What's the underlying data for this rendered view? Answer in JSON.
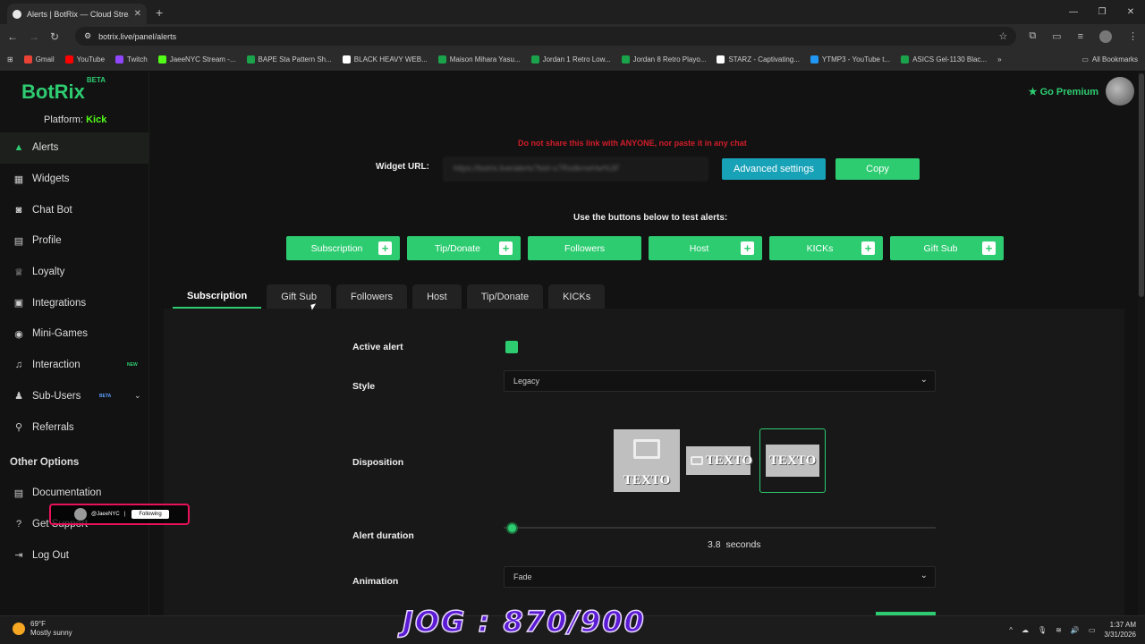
{
  "browser": {
    "tab_title": "Alerts | BotRix — Cloud Streami",
    "url": "botrix.live/panel/alerts",
    "bookmarks": [
      {
        "label": "Gmail",
        "color": "#ea4335"
      },
      {
        "label": "YouTube",
        "color": "#ff0000"
      },
      {
        "label": "Twitch",
        "color": "#9146ff"
      },
      {
        "label": "JaeeNYC Stream -...",
        "color": "#53fc18"
      },
      {
        "label": "BAPE Sta Pattern Sh...",
        "color": "#1aa34a"
      },
      {
        "label": "BLACK HEAVY WEB...",
        "color": "#ffffff"
      },
      {
        "label": "Maison Mihara Yasu...",
        "color": "#1aa34a"
      },
      {
        "label": "Jordan 1 Retro Low...",
        "color": "#1aa34a"
      },
      {
        "label": "Jordan 8 Retro Playo...",
        "color": "#1aa34a"
      },
      {
        "label": "STARZ - Captivating...",
        "color": "#ffffff"
      },
      {
        "label": "YTMP3 - YouTube t...",
        "color": "#2196f3"
      },
      {
        "label": "ASICS Gel-1130 Blac...",
        "color": "#1aa34a"
      }
    ],
    "all_bookmarks": "All Bookmarks"
  },
  "app": {
    "logo": "BotRix",
    "logo_badge": "BETA",
    "platform_label": "Platform:",
    "platform_value": "Kick",
    "go_premium": "Go Premium",
    "nav": [
      {
        "label": "Alerts",
        "icon": "warning-icon"
      },
      {
        "label": "Widgets",
        "icon": "grid-icon"
      },
      {
        "label": "Chat Bot",
        "icon": "robot-icon"
      },
      {
        "label": "Profile",
        "icon": "profile-card-icon"
      },
      {
        "label": "Loyalty",
        "icon": "trophy-icon"
      },
      {
        "label": "Integrations",
        "icon": "integrations-icon"
      },
      {
        "label": "Mini-Games",
        "icon": "gamepad-icon"
      },
      {
        "label": "Interaction",
        "icon": "music-icon",
        "badge": "NEW"
      },
      {
        "label": "Sub-Users",
        "icon": "users-icon",
        "badge": "BETA"
      },
      {
        "label": "Referrals",
        "icon": "referrals-icon"
      }
    ],
    "other_options_title": "Other Options",
    "other_nav": [
      {
        "label": "Documentation",
        "icon": "document-icon"
      },
      {
        "label": "Get Support",
        "icon": "help-icon"
      },
      {
        "label": "Log Out",
        "icon": "logout-icon"
      }
    ]
  },
  "main": {
    "warning": "Do not share this link with ANYONE, nor paste it in any chat",
    "widget_url_label": "Widget URL:",
    "widget_url_value": "https://botrix.live/alerts?bid=x7RsdkrrwHw%3F",
    "advanced_settings": "Advanced settings",
    "copy": "Copy",
    "test_label": "Use the buttons below to test alerts:",
    "test_buttons": [
      {
        "label": "Subscription",
        "plus": true
      },
      {
        "label": "Tip/Donate",
        "plus": true
      },
      {
        "label": "Followers",
        "plus": false
      },
      {
        "label": "Host",
        "plus": true
      },
      {
        "label": "KICKs",
        "plus": true
      },
      {
        "label": "Gift Sub",
        "plus": true
      }
    ],
    "tabs": [
      "Subscription",
      "Gift Sub",
      "Followers",
      "Host",
      "Tip/Donate",
      "KICKs"
    ],
    "active_tab": "Subscription",
    "form": {
      "active_alert_label": "Active alert",
      "active_alert_checked": true,
      "style_label": "Style",
      "style_value": "Legacy",
      "disposition_label": "Disposition",
      "disposition_text": "TEXTO",
      "alert_duration_label": "Alert duration",
      "alert_duration_value": "3.8",
      "alert_duration_unit": "seconds",
      "animation_label": "Animation",
      "animation_value": "Fade"
    }
  },
  "taskbar": {
    "temp": "69°F",
    "weather": "Mostly sunny",
    "time": "1:37 AM",
    "date": "3/31/2026"
  },
  "overlays": {
    "jog": "JOG : 870/900",
    "tiktok_user": "@JaeeNYC",
    "tiktok_follow": "Following"
  }
}
